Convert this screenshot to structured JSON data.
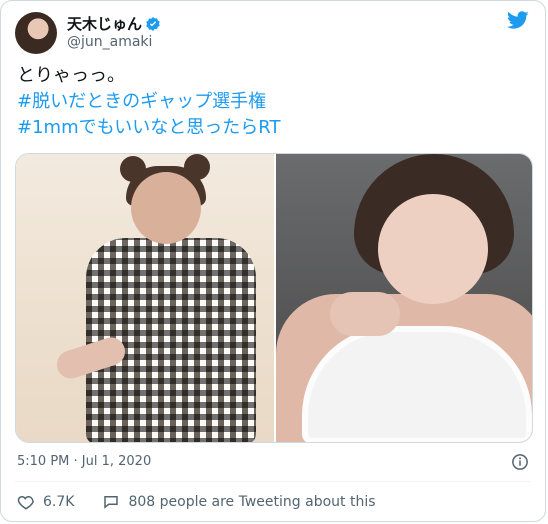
{
  "tweet": {
    "author": {
      "display_name": "天木じゅん",
      "handle": "@jun_amaki",
      "verified": true
    },
    "text_lines": [
      "とりゃっっ。",
      "#脱いだときのギャップ選手権",
      "#1mmでもいいなと思ったらRT"
    ],
    "timestamp": "5:10 PM · Jul 1, 2020"
  },
  "footer": {
    "like_count": "6.7K",
    "conversation_text": "808 people are Tweeting about this"
  },
  "colors": {
    "accent": "#1d9bf0",
    "text_primary": "#0f1419",
    "text_secondary": "#536471",
    "border": "#cfd9de"
  },
  "icons": {
    "brand": "twitter-bird-icon",
    "verified": "verified-badge-icon",
    "info": "info-icon",
    "like": "heart-icon",
    "reply": "speech-bubble-icon"
  }
}
